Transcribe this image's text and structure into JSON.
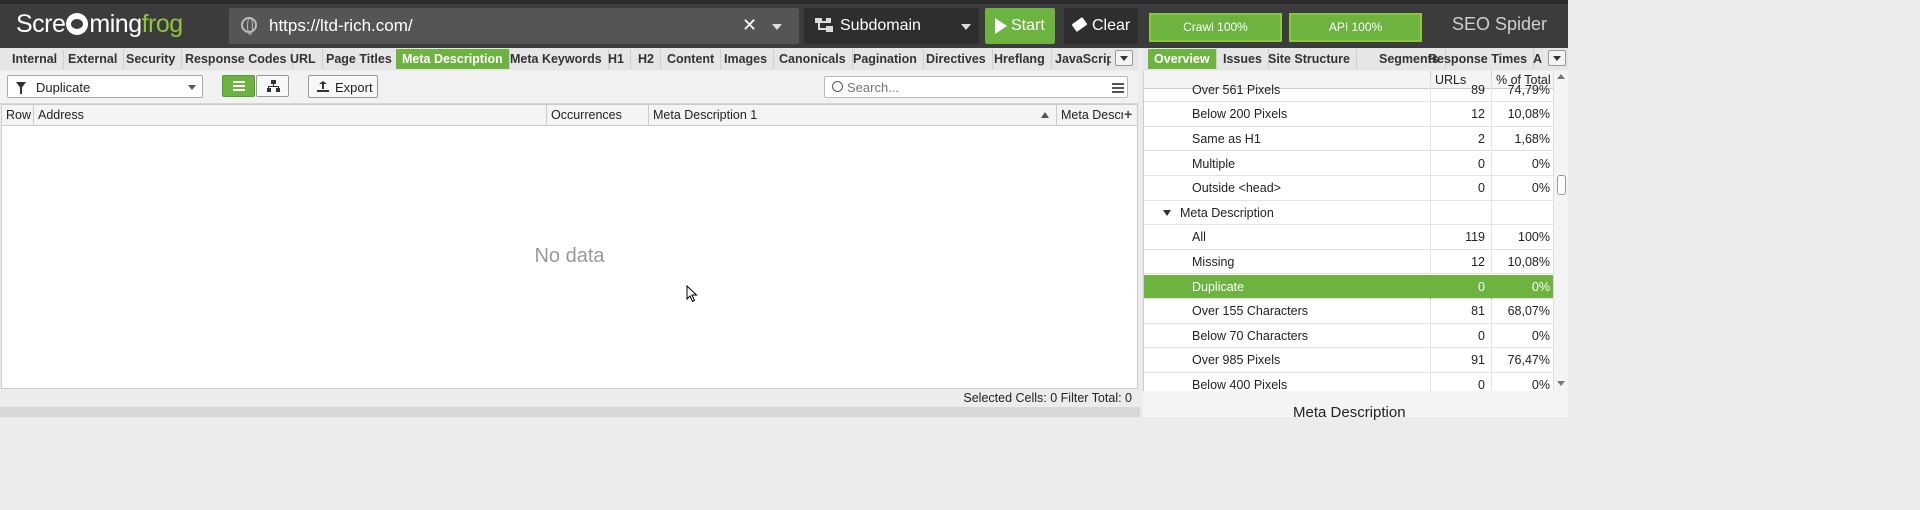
{
  "app": {
    "logo_pre": "Scre",
    "logo_mid": "ming",
    "logo_post": "frog",
    "brand": "SEO Spider"
  },
  "topbar": {
    "url": "https://ltd-rich.com/",
    "mode": "Subdomain",
    "start_label": "Start",
    "clear_label": "Clear",
    "crawl_progress": "Crawl 100%",
    "api_progress": "API 100%"
  },
  "left_tabs": [
    "Internal",
    "External",
    "Security",
    "Response Codes",
    "URL",
    "Page Titles",
    "Meta Description",
    "Meta Keywords",
    "H1",
    "H2",
    "Content",
    "Images",
    "Canonicals",
    "Pagination",
    "Directives",
    "Hreflang",
    "JavaScrip"
  ],
  "left_active_tab": "Meta Description",
  "right_tabs": [
    "Overview",
    "Issues",
    "Site Structure",
    "Segments",
    "Response Times",
    "A"
  ],
  "right_active_tab": "Overview",
  "toolbar": {
    "filter": "Duplicate",
    "export_label": "Export",
    "search_placeholder": "Search..."
  },
  "grid": {
    "columns": [
      "Row",
      "Address",
      "Occurrences",
      "Meta Description 1",
      "Meta Descr"
    ],
    "empty_text": "No data"
  },
  "statusbar": {
    "text": "Selected Cells:  0  Filter Total:  0"
  },
  "overview": {
    "headers": [
      "URLs",
      "% of Total"
    ],
    "rows": [
      {
        "name": "Over 561 Pixels",
        "urls": "89",
        "pct": "74,79%",
        "type": "item"
      },
      {
        "name": "Below 200 Pixels",
        "urls": "12",
        "pct": "10,08%",
        "type": "item"
      },
      {
        "name": "Same as H1",
        "urls": "2",
        "pct": "1,68%",
        "type": "item"
      },
      {
        "name": "Multiple",
        "urls": "0",
        "pct": "0%",
        "type": "item"
      },
      {
        "name": "Outside <head>",
        "urls": "0",
        "pct": "0%",
        "type": "item"
      },
      {
        "name": "Meta Description",
        "urls": "",
        "pct": "",
        "type": "section"
      },
      {
        "name": "All",
        "urls": "119",
        "pct": "100%",
        "type": "item"
      },
      {
        "name": "Missing",
        "urls": "12",
        "pct": "10,08%",
        "type": "item"
      },
      {
        "name": "Duplicate",
        "urls": "0",
        "pct": "0%",
        "type": "selected"
      },
      {
        "name": "Over 155 Characters",
        "urls": "81",
        "pct": "68,07%",
        "type": "item"
      },
      {
        "name": "Below 70 Characters",
        "urls": "0",
        "pct": "0%",
        "type": "item"
      },
      {
        "name": "Over 985 Pixels",
        "urls": "91",
        "pct": "76,47%",
        "type": "item"
      },
      {
        "name": "Below 400 Pixels",
        "urls": "0",
        "pct": "0%",
        "type": "item"
      }
    ],
    "chart_title": "Meta Description"
  },
  "colors": {
    "accent": "#6cb33f",
    "topbar": "#3c3c3c"
  }
}
